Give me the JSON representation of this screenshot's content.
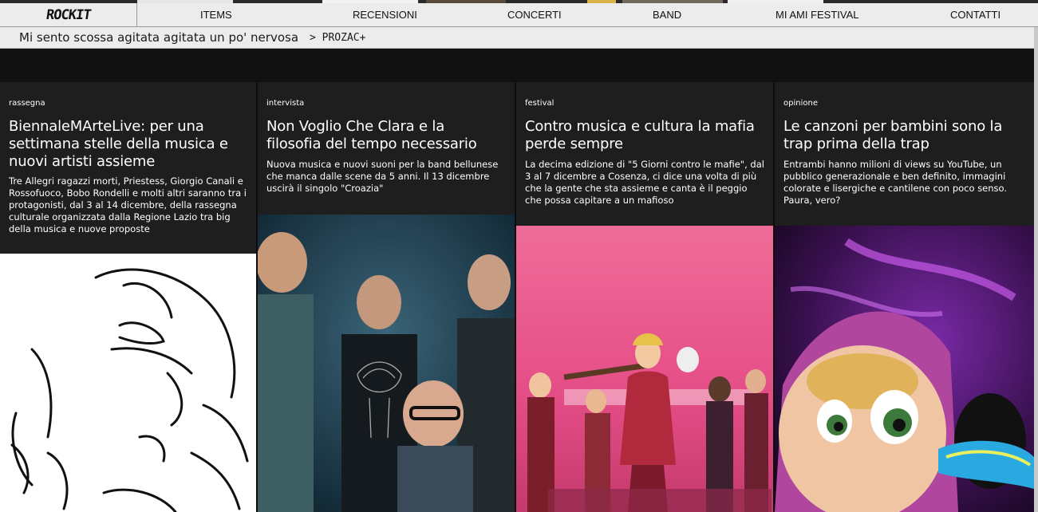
{
  "logo": {
    "text": "ROCKIT"
  },
  "nav": {
    "items": [
      "ITEMS",
      "RECENSIONI",
      "CONCERTI",
      "BAND",
      "MI AMI FESTIVAL",
      "CONTATTI"
    ]
  },
  "ticker": {
    "song": "Mi sento scossa agitata agitata un po' nervosa",
    "artist": "> PROZAC+"
  },
  "cards": [
    {
      "category": "rassegna",
      "title": "BiennaleMArteLive: per una settimana stelle della musica e nuovi artisti assieme",
      "excerpt": "Tre Allegri ragazzi morti, Priestess, Giorgio Canali e Rossofuoco, Bobo Rondelli e molti altri saranno tra i protagonisti, dal 3 al 14 dicembre, della rassegna culturale organizzata dalla Regione Lazio tra big della musica e nuove proposte"
    },
    {
      "category": "intervista",
      "title": "Non Voglio Che Clara e la filosofia del tempo necessario",
      "excerpt": "Nuova musica e nuovi suoni per la band bellunese che manca dalle scene da 5 anni. Il 13 dicembre uscirà il singolo \"Croazia\""
    },
    {
      "category": "festival",
      "title": "Contro musica e cultura la mafia perde sempre",
      "excerpt": "La decima edizione di \"5 Giorni contro le mafie\", dal 3 al 7 dicembre a Cosenza, ci dice una volta di più che la gente che sta assieme e canta è il peggio che possa capitare a un mafioso"
    },
    {
      "category": "opinione",
      "title": "Le canzoni per bambini sono la trap prima della trap",
      "excerpt": "Entrambi hanno milioni di views su YouTube, un pubblico generazionale e ben definito, immagini colorate e lisergiche e cantilene con poco senso. Paura, vero?"
    }
  ],
  "colors": {
    "nav_bg": "#ececec",
    "card_bg": "#1e1e1e",
    "band_bg": "#111111",
    "text_light": "#ffffff"
  }
}
